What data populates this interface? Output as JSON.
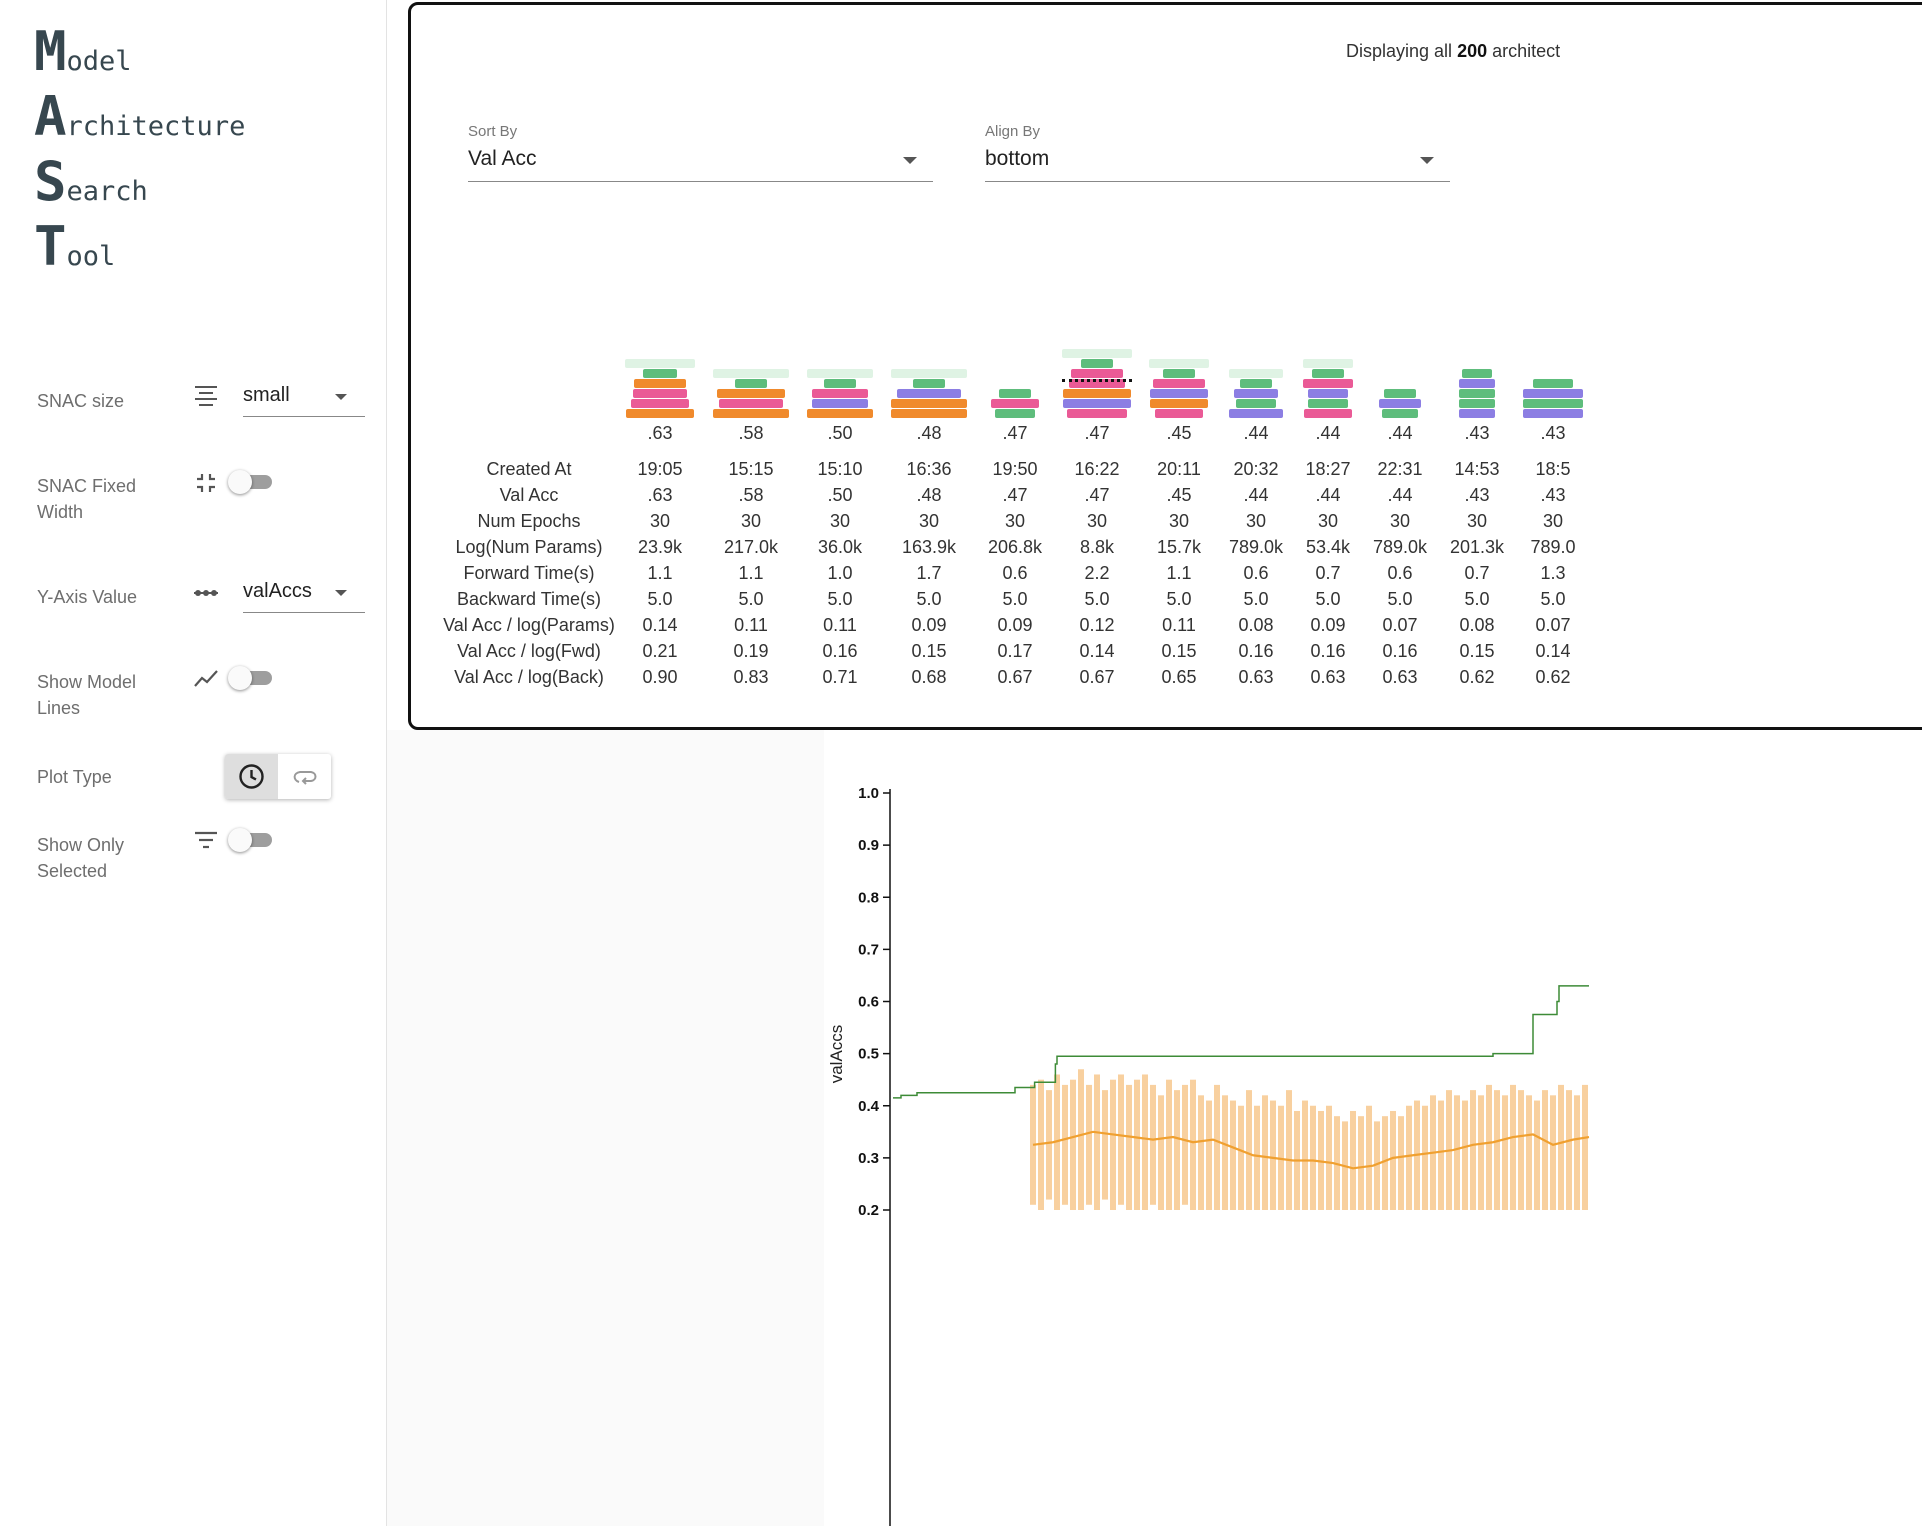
{
  "logo": [
    {
      "big": "M",
      "small": "odel"
    },
    {
      "big": "A",
      "small": "rchitecture"
    },
    {
      "big": "S",
      "small": "earch"
    },
    {
      "big": "T",
      "small": "ool"
    }
  ],
  "controls": {
    "snac_size": {
      "label": "SNAC size",
      "value": "small",
      "icon": "align-lines-icon"
    },
    "snac_fixed_width": {
      "label": "SNAC Fixed Width",
      "checked": false,
      "icon": "compress-icon"
    },
    "y_axis_value": {
      "label": "Y-Axis Value",
      "value": "valAccs",
      "icon": "dots-line-icon"
    },
    "show_model_lines": {
      "label": "Show Model Lines",
      "checked": false,
      "icon": "trend-line-icon"
    },
    "plot_type": {
      "label": "Plot Type",
      "options": [
        "clock-icon",
        "loop-icon"
      ],
      "selected": 0
    },
    "show_only_selected": {
      "label": "Show Only Selected",
      "checked": false,
      "icon": "filter-icon"
    }
  },
  "panel": {
    "display_prefix": "Displaying all ",
    "display_count": "200",
    "display_suffix": " architect",
    "sort_by": {
      "label": "Sort By",
      "value": "Val Acc"
    },
    "align_by": {
      "label": "Align By",
      "value": "bottom"
    }
  },
  "table": {
    "row_labels": [
      "Created At",
      "Val Acc",
      "Num Epochs",
      "Log(Num Params)",
      "Forward Time(s)",
      "Backward Time(s)",
      "Val Acc / log(Params)",
      "Val Acc / log(Fwd)",
      "Val Acc / log(Back)"
    ],
    "columns": [
      {
        "top": ".63",
        "values": [
          "19:05",
          ".63",
          "30",
          "23.9k",
          "1.1",
          "5.0",
          "0.14",
          "0.21",
          "0.90"
        ]
      },
      {
        "top": ".58",
        "values": [
          "15:15",
          ".58",
          "30",
          "217.0k",
          "1.1",
          "5.0",
          "0.11",
          "0.19",
          "0.83"
        ]
      },
      {
        "top": ".50",
        "values": [
          "15:10",
          ".50",
          "30",
          "36.0k",
          "1.0",
          "5.0",
          "0.11",
          "0.16",
          "0.71"
        ]
      },
      {
        "top": ".48",
        "values": [
          "16:36",
          ".48",
          "30",
          "163.9k",
          "1.7",
          "5.0",
          "0.09",
          "0.15",
          "0.68"
        ]
      },
      {
        "top": ".47",
        "values": [
          "19:50",
          ".47",
          "30",
          "206.8k",
          "0.6",
          "5.0",
          "0.09",
          "0.17",
          "0.67"
        ]
      },
      {
        "top": ".47",
        "values": [
          "16:22",
          ".47",
          "30",
          "8.8k",
          "2.2",
          "5.0",
          "0.12",
          "0.14",
          "0.67"
        ]
      },
      {
        "top": ".45",
        "values": [
          "20:11",
          ".45",
          "30",
          "15.7k",
          "1.1",
          "5.0",
          "0.11",
          "0.15",
          "0.65"
        ]
      },
      {
        "top": ".44",
        "values": [
          "20:32",
          ".44",
          "30",
          "789.0k",
          "0.6",
          "5.0",
          "0.08",
          "0.16",
          "0.63"
        ]
      },
      {
        "top": ".44",
        "values": [
          "18:27",
          ".44",
          "30",
          "53.4k",
          "0.7",
          "5.0",
          "0.09",
          "0.16",
          "0.63"
        ]
      },
      {
        "top": ".44",
        "values": [
          "22:31",
          ".44",
          "30",
          "789.0k",
          "0.6",
          "5.0",
          "0.07",
          "0.16",
          "0.63"
        ]
      },
      {
        "top": ".43",
        "values": [
          "14:53",
          ".43",
          "30",
          "201.3k",
          "0.7",
          "5.0",
          "0.08",
          "0.15",
          "0.62"
        ]
      },
      {
        "top": ".43",
        "values": [
          "18:5",
          ".43",
          "30",
          "789.0",
          "1.3",
          "5.0",
          "0.07",
          "0.14",
          "0.62"
        ]
      }
    ]
  },
  "snac_colors": {
    "green": "#5ebd7c",
    "orange": "#f08a2c",
    "pink": "#ea5a96",
    "purple": "#8c7ee3",
    "light_green": "#dff3e4",
    "light_pink": "#f9d4e3",
    "dashed": "#111111"
  },
  "chart_data": {
    "type": "line",
    "ylabel": "valAccs",
    "xlabel": "",
    "yticks": [
      "0.2",
      "0.3",
      "0.4",
      "0.5",
      "0.6",
      "0.7",
      "0.8",
      "0.9",
      "1.0"
    ],
    "ylim": [
      0.2,
      1.0
    ],
    "series": [
      {
        "color": "#3d8b37",
        "x": [
          0,
          2,
          4,
          6,
          30,
          30.5,
          35,
          35.4,
          40,
          40.6,
          41,
          150,
          160,
          165,
          166,
          166.5,
          170,
          174
        ],
        "values": [
          0.415,
          0.42,
          0.42,
          0.425,
          0.425,
          0.435,
          0.435,
          0.445,
          0.445,
          0.48,
          0.495,
          0.5,
          0.575,
          0.575,
          0.6,
          0.63,
          0.63,
          0.63
        ]
      },
      {
        "color": "#f0a030",
        "x": [
          35,
          40,
          45,
          50,
          55,
          60,
          65,
          70,
          75,
          80,
          85,
          90,
          95,
          100,
          105,
          110,
          115,
          120,
          125,
          130,
          135,
          140,
          145,
          150,
          155,
          160,
          165,
          170,
          174
        ],
        "values": [
          0.325,
          0.33,
          0.34,
          0.35,
          0.345,
          0.34,
          0.335,
          0.34,
          0.33,
          0.335,
          0.32,
          0.305,
          0.3,
          0.295,
          0.295,
          0.29,
          0.28,
          0.285,
          0.3,
          0.305,
          0.31,
          0.315,
          0.325,
          0.33,
          0.34,
          0.345,
          0.325,
          0.335,
          0.34
        ]
      },
      {
        "color": "#f7c88e",
        "kind": "range-bars",
        "x": [
          35,
          37,
          39,
          41,
          43,
          45,
          47,
          49,
          51,
          53,
          55,
          57,
          59,
          61,
          63,
          65,
          67,
          69,
          71,
          73,
          75,
          77,
          79,
          81,
          83,
          85,
          87,
          89,
          91,
          93,
          95,
          97,
          99,
          101,
          103,
          105,
          107,
          109,
          111,
          113,
          115,
          117,
          119,
          121,
          123,
          125,
          127,
          129,
          131,
          133,
          135,
          137,
          139,
          141,
          143,
          145,
          147,
          149,
          151,
          153,
          155,
          157,
          159,
          161,
          163,
          165,
          167,
          169,
          171,
          173
        ],
        "low": [
          0.21,
          0.2,
          0.22,
          0.2,
          0.21,
          0.2,
          0.2,
          0.21,
          0.2,
          0.22,
          0.2,
          0.21,
          0.2,
          0.2,
          0.2,
          0.21,
          0.2,
          0.2,
          0.2,
          0.21,
          0.2,
          0.2,
          0.2,
          0.2,
          0.2,
          0.2,
          0.2,
          0.2,
          0.2,
          0.2,
          0.2,
          0.2,
          0.2,
          0.2,
          0.2,
          0.2,
          0.2,
          0.2,
          0.2,
          0.2,
          0.2,
          0.2,
          0.2,
          0.2,
          0.2,
          0.2,
          0.2,
          0.2,
          0.2,
          0.2,
          0.2,
          0.2,
          0.2,
          0.2,
          0.2,
          0.2,
          0.2,
          0.2,
          0.2,
          0.2,
          0.2,
          0.2,
          0.2,
          0.2,
          0.2,
          0.2,
          0.2,
          0.2,
          0.2,
          0.2
        ],
        "high": [
          0.44,
          0.45,
          0.43,
          0.46,
          0.44,
          0.45,
          0.47,
          0.44,
          0.46,
          0.43,
          0.45,
          0.46,
          0.44,
          0.45,
          0.46,
          0.44,
          0.42,
          0.45,
          0.43,
          0.44,
          0.45,
          0.42,
          0.41,
          0.44,
          0.42,
          0.41,
          0.4,
          0.43,
          0.4,
          0.42,
          0.41,
          0.4,
          0.43,
          0.39,
          0.41,
          0.4,
          0.39,
          0.4,
          0.38,
          0.37,
          0.39,
          0.38,
          0.4,
          0.37,
          0.38,
          0.39,
          0.38,
          0.4,
          0.41,
          0.4,
          0.42,
          0.41,
          0.43,
          0.42,
          0.41,
          0.43,
          0.42,
          0.44,
          0.43,
          0.42,
          0.44,
          0.43,
          0.42,
          0.41,
          0.43,
          0.42,
          0.44,
          0.43,
          0.42,
          0.44
        ]
      }
    ]
  }
}
